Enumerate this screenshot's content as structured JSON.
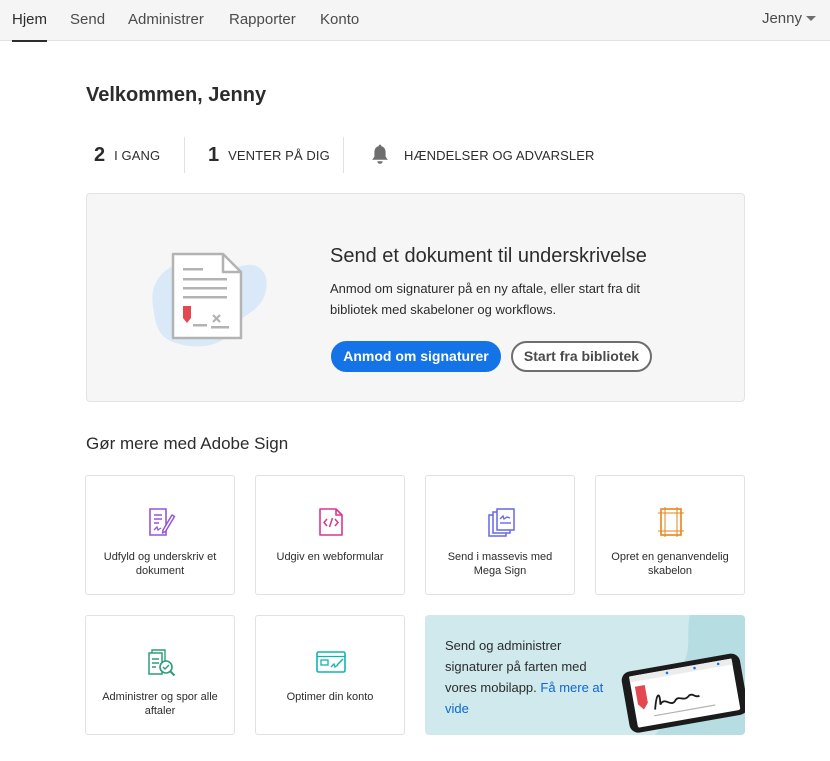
{
  "nav": {
    "items": [
      {
        "label": "Hjem",
        "active": true
      },
      {
        "label": "Send",
        "active": false
      },
      {
        "label": "Administrer",
        "active": false
      },
      {
        "label": "Rapporter",
        "active": false
      },
      {
        "label": "Konto",
        "active": false
      }
    ],
    "user": "Jenny"
  },
  "welcome": "Velkommen, Jenny",
  "stats": {
    "in_progress": {
      "count": "2",
      "label": "I GANG"
    },
    "waiting": {
      "count": "1",
      "label": "VENTER PÅ DIG"
    },
    "events": {
      "label": "HÆNDELSER OG ADVARSLER",
      "icon": "bell-icon"
    }
  },
  "hero": {
    "title": "Send et dokument til underskrivelse",
    "description": "Anmod om signaturer på en ny aftale, eller start fra dit bibliotek med skabeloner og workflows.",
    "primary_button": "Anmod om signaturer",
    "secondary_button": "Start fra bibliotek",
    "icon": "document-signature-icon"
  },
  "more": {
    "title": "Gør mere med Adobe Sign",
    "tiles": [
      {
        "label": "Udfyld og underskriv et dokument",
        "icon": "fill-sign-icon",
        "color": "#9256d9"
      },
      {
        "label": "Udgiv en webformular",
        "icon": "web-form-icon",
        "color": "#d83790"
      },
      {
        "label": "Send i massevis med Mega Sign",
        "icon": "mega-sign-icon",
        "color": "#6767ec"
      },
      {
        "label": "Opret en genanvendelig skabelon",
        "icon": "template-icon",
        "color": "#e68619"
      },
      {
        "label": "Administrer og spor alle aftaler",
        "icon": "manage-track-icon",
        "color": "#2d9d78"
      },
      {
        "label": "Optimer din konto",
        "icon": "optimize-account-icon",
        "color": "#0fb5ae"
      }
    ],
    "promo": {
      "text": "Send og administrer signaturer på farten med vores mobilapp.",
      "link": "Få mere at vide",
      "icon": "mobile-phone-signature-icon"
    }
  },
  "colors": {
    "accent": "#1473e6",
    "link": "#0d66d0",
    "promo_bg": "#cfe9ec",
    "signature_red": "#e34850"
  }
}
